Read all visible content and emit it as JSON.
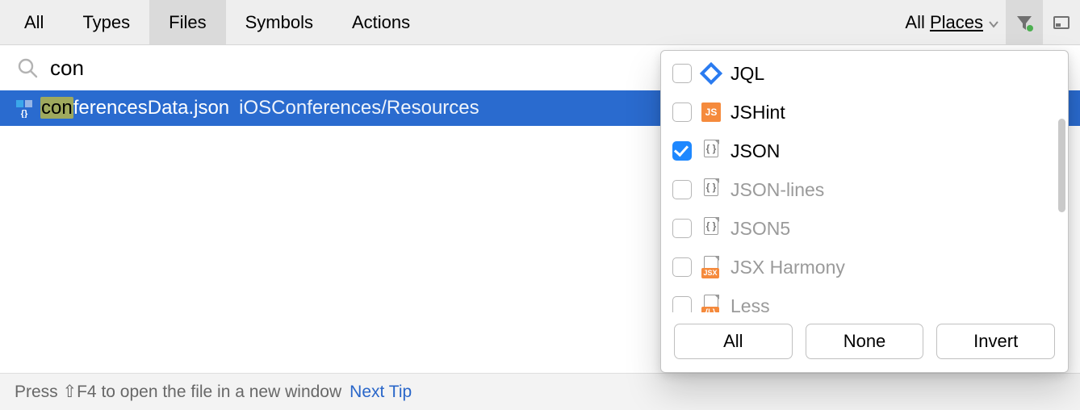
{
  "tabs": {
    "all": "All",
    "types": "Types",
    "files": "Files",
    "symbols": "Symbols",
    "actions": "Actions"
  },
  "scope": {
    "prefix": "All ",
    "word": "Places"
  },
  "search": {
    "value": "con"
  },
  "result": {
    "match": "con",
    "rest": "ferencesData.json",
    "location": "iOSConferences/Resources"
  },
  "filters": [
    {
      "label": "JQL",
      "checked": false,
      "dim": false
    },
    {
      "label": "JSHint",
      "checked": false,
      "dim": false
    },
    {
      "label": "JSON",
      "checked": true,
      "dim": false
    },
    {
      "label": "JSON-lines",
      "checked": false,
      "dim": true
    },
    {
      "label": "JSON5",
      "checked": false,
      "dim": true
    },
    {
      "label": "JSX Harmony",
      "checked": false,
      "dim": true
    },
    {
      "label": "Less",
      "checked": false,
      "dim": true
    }
  ],
  "buttons": {
    "all": "All",
    "none": "None",
    "invert": "Invert"
  },
  "footer": {
    "text": "Press ⇧F4 to open the file in a new window",
    "link": "Next Tip"
  }
}
